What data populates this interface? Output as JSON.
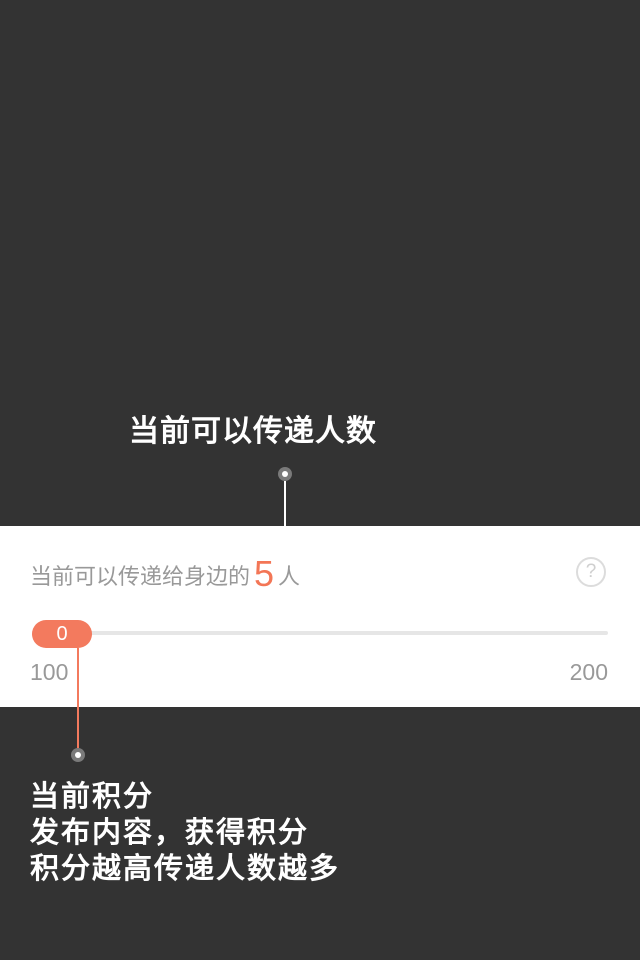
{
  "callouts": {
    "top": {
      "label": "当前可以传递人数"
    },
    "bottom": {
      "lines": [
        "当前积分",
        "发布内容，获得积分",
        "积分越高传递人数越多"
      ]
    }
  },
  "panel": {
    "info_prefix": "当前可以传递给身边的",
    "count": "5",
    "info_suffix": "人",
    "help_icon": "question-circle-icon",
    "slider": {
      "value_label": "0",
      "progress": 0,
      "min_label": "100",
      "max_label": "200"
    }
  },
  "colors": {
    "background": "#333333",
    "panel": "#ffffff",
    "accent": "#f37a5e",
    "muted_text": "#999999"
  }
}
